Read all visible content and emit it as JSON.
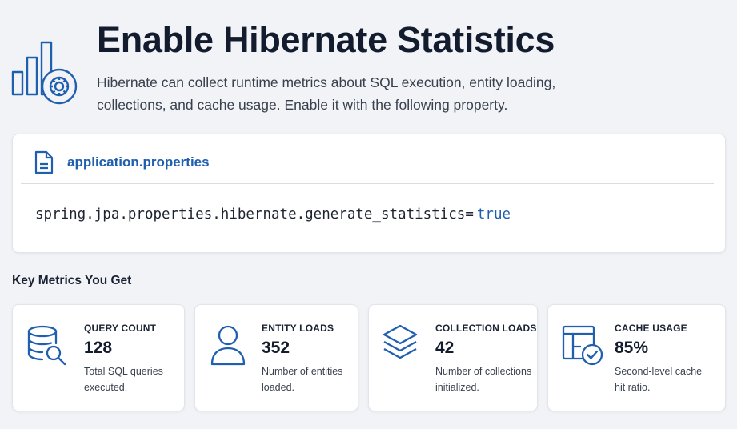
{
  "header": {
    "title": "Enable Hibernate Statistics",
    "description": "Hibernate can collect runtime metrics about SQL execution, entity loading, collections, and cache usage. Enable it with the following property.",
    "icon": "bar-chart-gear-icon"
  },
  "code_card": {
    "file_name": "application.properties",
    "file_icon": "document-icon",
    "property_key": "spring.jpa.properties.hibernate.generate_statistics=",
    "property_value": "true"
  },
  "metrics_section": {
    "title": "Key Metrics You Get",
    "cards": [
      {
        "label": "QUERY COUNT",
        "value": "128",
        "caption": "Total SQL queries executed.",
        "icon": "database-search-icon"
      },
      {
        "label": "ENTITY LOADS",
        "value": "352",
        "caption": "Number of entities loaded.",
        "icon": "user-icon"
      },
      {
        "label": "COLLECTION LOADS",
        "value": "42",
        "caption": "Number of collections initialized.",
        "icon": "layers-icon"
      },
      {
        "label": "CACHE USAGE",
        "value": "85%",
        "caption": "Second-level cache hit ratio.",
        "icon": "cache-check-icon"
      }
    ]
  },
  "colors": {
    "accent": "#1f5fb0",
    "background": "#f1f3f6",
    "card": "#ffffff",
    "text": "#1a2233"
  }
}
